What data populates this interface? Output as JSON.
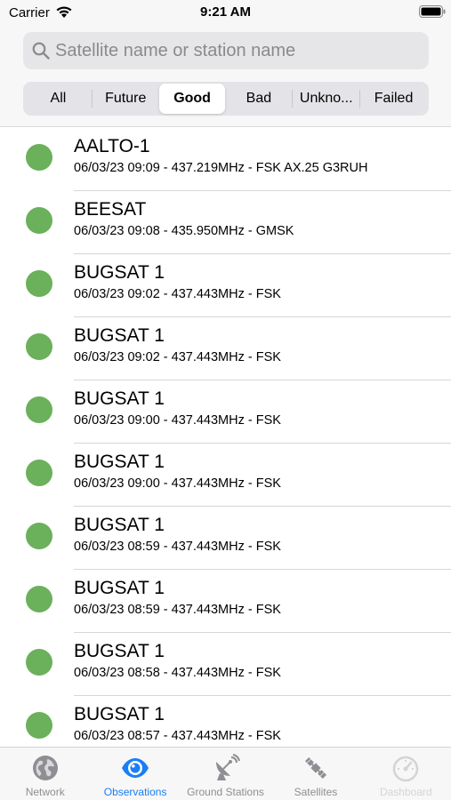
{
  "status_bar": {
    "carrier": "Carrier",
    "time": "9:21 AM"
  },
  "search": {
    "placeholder": "Satellite name or station name",
    "value": ""
  },
  "filter_segments": [
    {
      "label": "All",
      "selected": false
    },
    {
      "label": "Future",
      "selected": false
    },
    {
      "label": "Good",
      "selected": true
    },
    {
      "label": "Bad",
      "selected": false
    },
    {
      "label": "Unkno...",
      "selected": false
    },
    {
      "label": "Failed",
      "selected": false
    }
  ],
  "observations": [
    {
      "title": "AALTO-1",
      "detail": "06/03/23 09:09 - 437.219MHz - FSK AX.25 G3RUH",
      "status": "good"
    },
    {
      "title": "BEESAT",
      "detail": "06/03/23 09:08 - 435.950MHz - GMSK",
      "status": "good"
    },
    {
      "title": "BUGSAT 1",
      "detail": "06/03/23 09:02 - 437.443MHz - FSK",
      "status": "good"
    },
    {
      "title": "BUGSAT 1",
      "detail": "06/03/23 09:02 - 437.443MHz - FSK",
      "status": "good"
    },
    {
      "title": "BUGSAT 1",
      "detail": "06/03/23 09:00 - 437.443MHz - FSK",
      "status": "good"
    },
    {
      "title": "BUGSAT 1",
      "detail": "06/03/23 09:00 - 437.443MHz - FSK",
      "status": "good"
    },
    {
      "title": "BUGSAT 1",
      "detail": "06/03/23 08:59 - 437.443MHz - FSK",
      "status": "good"
    },
    {
      "title": "BUGSAT 1",
      "detail": "06/03/23 08:59 - 437.443MHz - FSK",
      "status": "good"
    },
    {
      "title": "BUGSAT 1",
      "detail": "06/03/23 08:58 - 437.443MHz - FSK",
      "status": "good"
    },
    {
      "title": "BUGSAT 1",
      "detail": "06/03/23 08:57 - 437.443MHz - FSK",
      "status": "good"
    }
  ],
  "tabbar": {
    "network": "Network",
    "observations": "Observations",
    "ground_stations": "Ground Stations",
    "satellites": "Satellites",
    "dashboard": "Dashboard"
  },
  "colors": {
    "status_good": "#6bb05a",
    "accent": "#1a7ef5"
  }
}
